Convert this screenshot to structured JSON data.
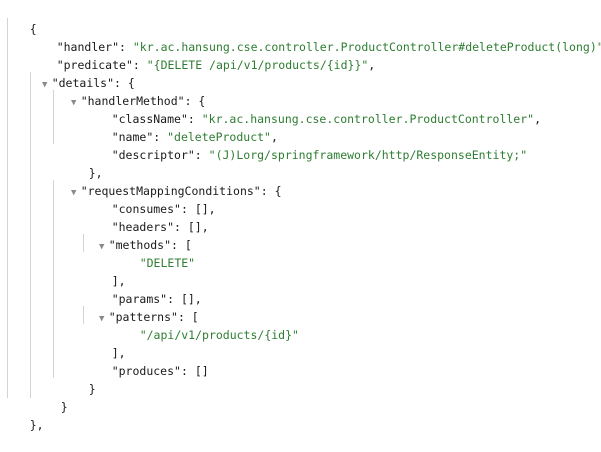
{
  "json_view": {
    "root_open": "{",
    "root_close": "},",
    "handler": {
      "key": "\"handler\"",
      "value": "\"kr.ac.hansung.cse.controller.ProductController#deleteProduct(long)\""
    },
    "predicate": {
      "key": "\"predicate\"",
      "value": "\"{DELETE /api/v1/products/{id}}\""
    },
    "details": {
      "key": "\"details\"",
      "close": "}",
      "handlerMethod": {
        "key": "\"handlerMethod\"",
        "close": "},",
        "className": {
          "key": "\"className\"",
          "value": "\"kr.ac.hansung.cse.controller.ProductController\""
        },
        "name": {
          "key": "\"name\"",
          "value": "\"deleteProduct\""
        },
        "descriptor": {
          "key": "\"descriptor\"",
          "value": "\"(J)Lorg/springframework/http/ResponseEntity;\""
        }
      },
      "requestMappingConditions": {
        "key": "\"requestMappingConditions\"",
        "close": "}",
        "consumes": {
          "key": "\"consumes\"",
          "value": "[],"
        },
        "headers": {
          "key": "\"headers\"",
          "value": "[],"
        },
        "methods": {
          "key": "\"methods\"",
          "close": "],",
          "items": [
            "\"DELETE\""
          ]
        },
        "params": {
          "key": "\"params\"",
          "value": "[],"
        },
        "patterns": {
          "key": "\"patterns\"",
          "close": "],",
          "items": [
            "\"/api/v1/products/{id}\""
          ]
        },
        "produces": {
          "key": "\"produces\"",
          "value": "[]"
        }
      }
    },
    "toggle_glyph": "▼"
  }
}
